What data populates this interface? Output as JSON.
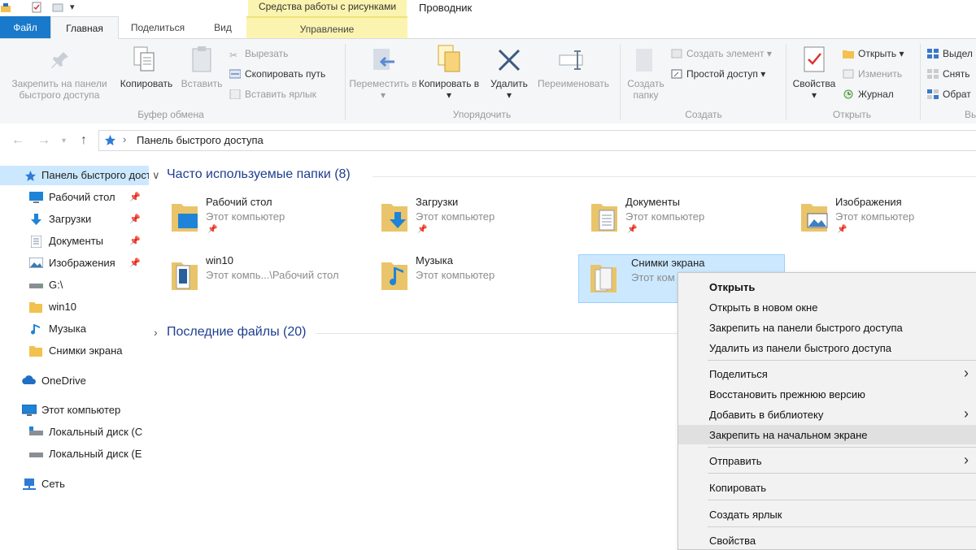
{
  "titlebar": {
    "context_tab": "Средства работы с рисунками",
    "window_title": "Проводник"
  },
  "tabs": {
    "file": "Файл",
    "home": "Главная",
    "share": "Поделиться",
    "view": "Вид",
    "manage": "Управление"
  },
  "ribbon": {
    "clipboard": {
      "pin": "Закрепить на панели быстрого доступа",
      "copy": "Копировать",
      "paste": "Вставить",
      "cut": "Вырезать",
      "copy_path": "Скопировать путь",
      "paste_shortcut": "Вставить ярлык",
      "label": "Буфер обмена"
    },
    "organize": {
      "move_to": "Переместить в",
      "copy_to": "Копировать в",
      "delete": "Удалить",
      "rename": "Переименовать",
      "label": "Упорядочить"
    },
    "new": {
      "new_folder": "Создать папку",
      "new_item": "Создать элемент",
      "easy_access": "Простой доступ",
      "label": "Создать"
    },
    "open": {
      "properties": "Свойства",
      "open": "Открыть",
      "edit": "Изменить",
      "history": "Журнал",
      "label": "Открыть"
    },
    "select": {
      "select_all": "Выдел",
      "select_none": "Снять",
      "invert": "Обрат",
      "label": "Вы"
    }
  },
  "address": {
    "path": "Панель быстрого доступа"
  },
  "navpane": {
    "items": [
      {
        "label": "Панель быстрого доступа",
        "icon": "star-icon"
      },
      {
        "label": "Рабочий стол",
        "icon": "desktop-icon"
      },
      {
        "label": "Загрузки",
        "icon": "download-icon"
      },
      {
        "label": "Документы",
        "icon": "documents-icon"
      },
      {
        "label": "Изображения",
        "icon": "pictures-icon"
      },
      {
        "label": "G:\\",
        "icon": "drive-icon"
      },
      {
        "label": "win10",
        "icon": "folder-icon"
      },
      {
        "label": "Музыка",
        "icon": "music-icon"
      },
      {
        "label": "Снимки экрана",
        "icon": "folder-icon"
      },
      {
        "label": "OneDrive",
        "icon": "cloud-icon"
      },
      {
        "label": "Этот компьютер",
        "icon": "computer-icon"
      },
      {
        "label": "Локальный диск (C",
        "icon": "drive-icon"
      },
      {
        "label": "Локальный диск (E",
        "icon": "drive-icon"
      },
      {
        "label": "Сеть",
        "icon": "network-icon"
      }
    ]
  },
  "content": {
    "frequent_header": "Часто используемые папки (8)",
    "recent_header": "Последние файлы (20)",
    "tiles": [
      {
        "name": "Рабочий стол",
        "sub": "Этот компьютер",
        "icon": "desktop-folder-icon",
        "pinned": true
      },
      {
        "name": "Загрузки",
        "sub": "Этот компьютер",
        "icon": "downloads-folder-icon",
        "pinned": true
      },
      {
        "name": "Документы",
        "sub": "Этот компьютер",
        "icon": "documents-folder-icon",
        "pinned": true
      },
      {
        "name": "Изображения",
        "sub": "Этот компьютер",
        "icon": "pictures-folder-icon",
        "pinned": true
      },
      {
        "name": "win10",
        "sub": "Этот компь...\\Рабочий стол",
        "icon": "folder-icon",
        "pinned": false
      },
      {
        "name": "Музыка",
        "sub": "Этот компьютер",
        "icon": "music-folder-icon",
        "pinned": false
      },
      {
        "name": "Снимки экрана",
        "sub": "Этот ком",
        "icon": "folder-icon",
        "pinned": false
      }
    ]
  },
  "context_menu": {
    "items": [
      {
        "label": "Открыть",
        "bold": true
      },
      {
        "label": "Открыть в новом окне"
      },
      {
        "label": "Закрепить на панели быстрого доступа"
      },
      {
        "label": "Удалить из панели быстрого доступа"
      },
      {
        "label": "Поделиться",
        "submenu": true
      },
      {
        "label": "Восстановить прежнюю версию"
      },
      {
        "label": "Добавить в библиотеку",
        "submenu": true
      },
      {
        "label": "Закрепить на начальном экране",
        "highlighted": true
      },
      {
        "label": "Отправить",
        "submenu": true
      },
      {
        "label": "Копировать"
      },
      {
        "label": "Создать ярлык"
      },
      {
        "label": "Свойства"
      }
    ]
  },
  "colors": {
    "accent": "#1979ca",
    "context_tab": "#fbf4b0",
    "selection": "#cce8ff",
    "section_header": "#1e3e8f"
  }
}
